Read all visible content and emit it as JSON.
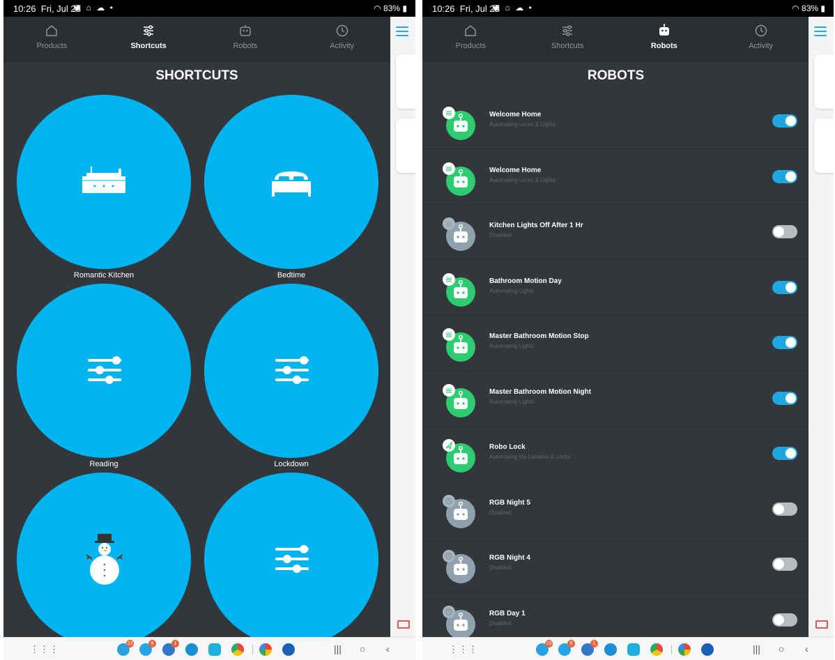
{
  "status": {
    "time": "10:26",
    "date": "Fri, Jul 28",
    "battery": "83%"
  },
  "nav": {
    "products": "Products",
    "shortcuts": "Shortcuts",
    "robots": "Robots",
    "activity": "Activity"
  },
  "shortcuts": {
    "title": "SHORTCUTS",
    "items": [
      {
        "label": "Romantic Kitchen",
        "icon": "stove-icon"
      },
      {
        "label": "Bedtime",
        "icon": "bed-icon"
      },
      {
        "label": "Reading",
        "icon": "sliders-icon"
      },
      {
        "label": "Lockdown",
        "icon": "sliders-icon"
      },
      {
        "label": "",
        "icon": "snowman-icon"
      },
      {
        "label": "",
        "icon": "sliders-icon"
      }
    ]
  },
  "robots": {
    "title": "ROBOTS",
    "items": [
      {
        "name": "Welcome Home",
        "status": "Automating Locks & Lights",
        "enabled": true,
        "icon": "sliders-icon"
      },
      {
        "name": "Welcome Home",
        "status": "Automating Locks & Lights",
        "enabled": true,
        "icon": "sliders-icon"
      },
      {
        "name": "Kitchen Lights Off After 1 Hr",
        "status": "Disabled",
        "enabled": false,
        "icon": "sliders-icon"
      },
      {
        "name": "Bathroom Motion Day",
        "status": "Automating Lights",
        "enabled": true,
        "icon": "sliders-icon"
      },
      {
        "name": "Master Bathroom Motion Stop",
        "status": "Automating Lights",
        "enabled": true,
        "icon": "sliders-icon"
      },
      {
        "name": "Master Bathroom Motion Night",
        "status": "Automating Lights",
        "enabled": true,
        "icon": "sliders-icon"
      },
      {
        "name": "Robo Lock",
        "status": "Automating My Location & Locks",
        "enabled": true,
        "icon": "location-arrow-icon"
      },
      {
        "name": "RGB Night 5",
        "status": "Disabled",
        "enabled": false,
        "icon": "clock-icon"
      },
      {
        "name": "RGB Night 4",
        "status": "Disabled",
        "enabled": false,
        "icon": "clock-icon"
      },
      {
        "name": "RGB Day 1",
        "status": "Disabled",
        "enabled": false,
        "icon": "clock-icon"
      }
    ]
  },
  "taskbar": {
    "badges": [
      "23",
      "9",
      "1"
    ]
  },
  "colors": {
    "accent": "#00b4ef",
    "toggle_on": "#1ea7e1",
    "robot_active": "#2ecc71",
    "robot_disabled": "#8fa1ad",
    "background": "#33373b"
  }
}
